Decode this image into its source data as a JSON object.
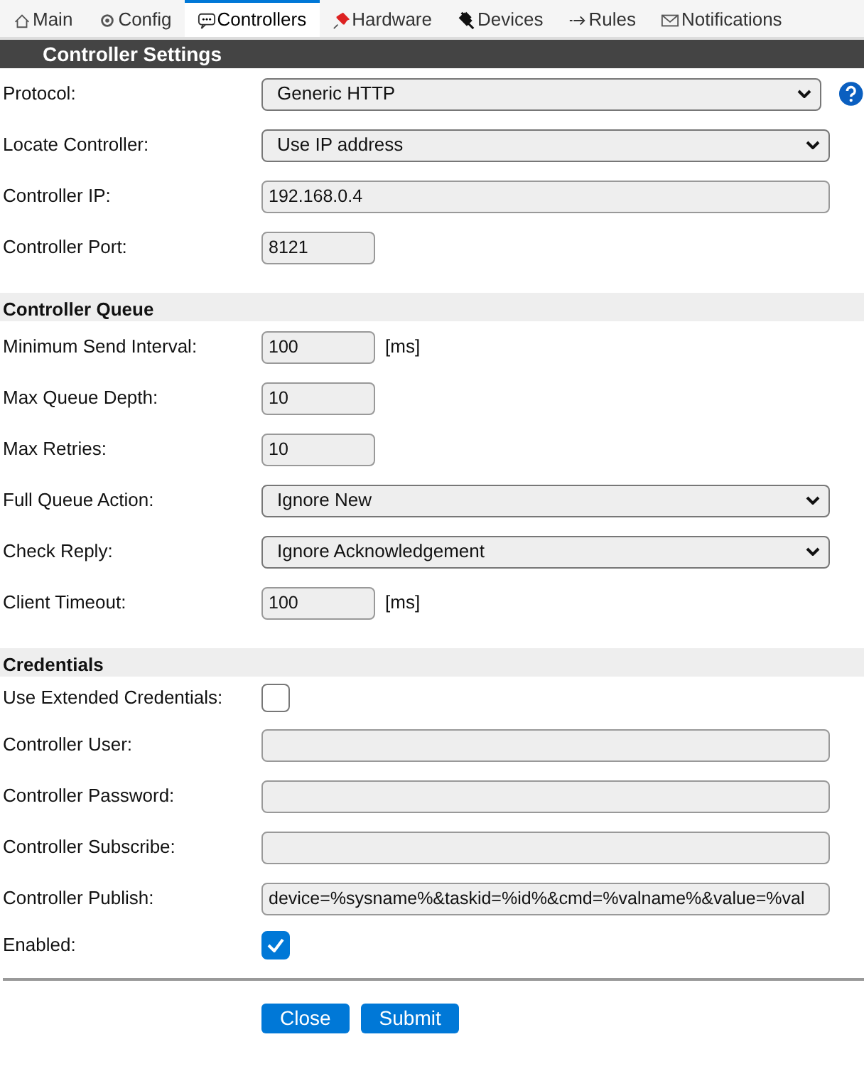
{
  "tabs": [
    {
      "label": "Main",
      "selected": false
    },
    {
      "label": "Config",
      "selected": false
    },
    {
      "label": "Controllers",
      "selected": true
    },
    {
      "label": "Hardware",
      "selected": false
    },
    {
      "label": "Devices",
      "selected": false
    },
    {
      "label": "Rules",
      "selected": false
    },
    {
      "label": "Notifications",
      "selected": false
    }
  ],
  "title": "Controller Settings",
  "sections": [
    {
      "rows": [
        {
          "label": "Protocol:",
          "kind": "select",
          "value": "Generic HTTP",
          "help": true
        },
        {
          "label": "Locate Controller:",
          "kind": "select",
          "value": "Use IP address"
        },
        {
          "label": "Controller IP:",
          "kind": "wide",
          "value": "192.168.0.4"
        },
        {
          "label": "Controller Port:",
          "kind": "short",
          "value": "8121"
        }
      ]
    },
    {
      "heading": "Controller Queue",
      "rows": [
        {
          "label": "Minimum Send Interval:",
          "kind": "short",
          "value": "100",
          "unit": "[ms]"
        },
        {
          "label": "Max Queue Depth:",
          "kind": "short",
          "value": "10"
        },
        {
          "label": "Max Retries:",
          "kind": "short",
          "value": "10"
        },
        {
          "label": "Full Queue Action:",
          "kind": "select",
          "value": "Ignore New"
        },
        {
          "label": "Check Reply:",
          "kind": "select",
          "value": "Ignore Acknowledgement"
        },
        {
          "label": "Client Timeout:",
          "kind": "short",
          "value": "100",
          "unit": "[ms]"
        }
      ]
    },
    {
      "heading": "Credentials",
      "rows": [
        {
          "label": "Use Extended Credentials:",
          "kind": "checkbox",
          "checked": false
        },
        {
          "label": "Controller User:",
          "kind": "wide",
          "value": ""
        },
        {
          "label": "Controller Password:",
          "kind": "wide",
          "value": ""
        },
        {
          "label": "Controller Subscribe:",
          "kind": "wide",
          "value": ""
        },
        {
          "label": "Controller Publish:",
          "kind": "wide",
          "value": "device=%sysname%&taskid=%id%&cmd=%valname%&value=%val"
        },
        {
          "label": "Enabled:",
          "kind": "checkbox",
          "checked": true
        }
      ]
    }
  ],
  "buttons": [
    "Close",
    "Submit"
  ]
}
